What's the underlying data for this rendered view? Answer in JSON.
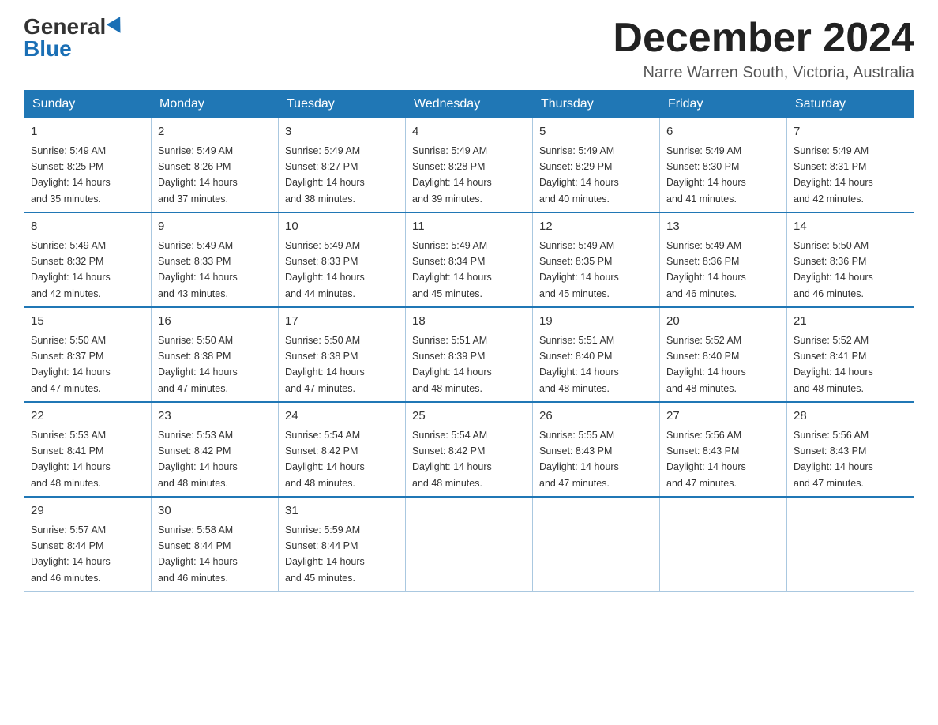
{
  "header": {
    "logo_general": "General",
    "logo_blue": "Blue",
    "month_title": "December 2024",
    "location": "Narre Warren South, Victoria, Australia"
  },
  "days_of_week": [
    "Sunday",
    "Monday",
    "Tuesday",
    "Wednesday",
    "Thursday",
    "Friday",
    "Saturday"
  ],
  "weeks": [
    [
      {
        "day": "1",
        "sunrise": "5:49 AM",
        "sunset": "8:25 PM",
        "daylight": "14 hours and 35 minutes."
      },
      {
        "day": "2",
        "sunrise": "5:49 AM",
        "sunset": "8:26 PM",
        "daylight": "14 hours and 37 minutes."
      },
      {
        "day": "3",
        "sunrise": "5:49 AM",
        "sunset": "8:27 PM",
        "daylight": "14 hours and 38 minutes."
      },
      {
        "day": "4",
        "sunrise": "5:49 AM",
        "sunset": "8:28 PM",
        "daylight": "14 hours and 39 minutes."
      },
      {
        "day": "5",
        "sunrise": "5:49 AM",
        "sunset": "8:29 PM",
        "daylight": "14 hours and 40 minutes."
      },
      {
        "day": "6",
        "sunrise": "5:49 AM",
        "sunset": "8:30 PM",
        "daylight": "14 hours and 41 minutes."
      },
      {
        "day": "7",
        "sunrise": "5:49 AM",
        "sunset": "8:31 PM",
        "daylight": "14 hours and 42 minutes."
      }
    ],
    [
      {
        "day": "8",
        "sunrise": "5:49 AM",
        "sunset": "8:32 PM",
        "daylight": "14 hours and 42 minutes."
      },
      {
        "day": "9",
        "sunrise": "5:49 AM",
        "sunset": "8:33 PM",
        "daylight": "14 hours and 43 minutes."
      },
      {
        "day": "10",
        "sunrise": "5:49 AM",
        "sunset": "8:33 PM",
        "daylight": "14 hours and 44 minutes."
      },
      {
        "day": "11",
        "sunrise": "5:49 AM",
        "sunset": "8:34 PM",
        "daylight": "14 hours and 45 minutes."
      },
      {
        "day": "12",
        "sunrise": "5:49 AM",
        "sunset": "8:35 PM",
        "daylight": "14 hours and 45 minutes."
      },
      {
        "day": "13",
        "sunrise": "5:49 AM",
        "sunset": "8:36 PM",
        "daylight": "14 hours and 46 minutes."
      },
      {
        "day": "14",
        "sunrise": "5:50 AM",
        "sunset": "8:36 PM",
        "daylight": "14 hours and 46 minutes."
      }
    ],
    [
      {
        "day": "15",
        "sunrise": "5:50 AM",
        "sunset": "8:37 PM",
        "daylight": "14 hours and 47 minutes."
      },
      {
        "day": "16",
        "sunrise": "5:50 AM",
        "sunset": "8:38 PM",
        "daylight": "14 hours and 47 minutes."
      },
      {
        "day": "17",
        "sunrise": "5:50 AM",
        "sunset": "8:38 PM",
        "daylight": "14 hours and 47 minutes."
      },
      {
        "day": "18",
        "sunrise": "5:51 AM",
        "sunset": "8:39 PM",
        "daylight": "14 hours and 48 minutes."
      },
      {
        "day": "19",
        "sunrise": "5:51 AM",
        "sunset": "8:40 PM",
        "daylight": "14 hours and 48 minutes."
      },
      {
        "day": "20",
        "sunrise": "5:52 AM",
        "sunset": "8:40 PM",
        "daylight": "14 hours and 48 minutes."
      },
      {
        "day": "21",
        "sunrise": "5:52 AM",
        "sunset": "8:41 PM",
        "daylight": "14 hours and 48 minutes."
      }
    ],
    [
      {
        "day": "22",
        "sunrise": "5:53 AM",
        "sunset": "8:41 PM",
        "daylight": "14 hours and 48 minutes."
      },
      {
        "day": "23",
        "sunrise": "5:53 AM",
        "sunset": "8:42 PM",
        "daylight": "14 hours and 48 minutes."
      },
      {
        "day": "24",
        "sunrise": "5:54 AM",
        "sunset": "8:42 PM",
        "daylight": "14 hours and 48 minutes."
      },
      {
        "day": "25",
        "sunrise": "5:54 AM",
        "sunset": "8:42 PM",
        "daylight": "14 hours and 48 minutes."
      },
      {
        "day": "26",
        "sunrise": "5:55 AM",
        "sunset": "8:43 PM",
        "daylight": "14 hours and 47 minutes."
      },
      {
        "day": "27",
        "sunrise": "5:56 AM",
        "sunset": "8:43 PM",
        "daylight": "14 hours and 47 minutes."
      },
      {
        "day": "28",
        "sunrise": "5:56 AM",
        "sunset": "8:43 PM",
        "daylight": "14 hours and 47 minutes."
      }
    ],
    [
      {
        "day": "29",
        "sunrise": "5:57 AM",
        "sunset": "8:44 PM",
        "daylight": "14 hours and 46 minutes."
      },
      {
        "day": "30",
        "sunrise": "5:58 AM",
        "sunset": "8:44 PM",
        "daylight": "14 hours and 46 minutes."
      },
      {
        "day": "31",
        "sunrise": "5:59 AM",
        "sunset": "8:44 PM",
        "daylight": "14 hours and 45 minutes."
      },
      null,
      null,
      null,
      null
    ]
  ],
  "labels": {
    "sunrise": "Sunrise:",
    "sunset": "Sunset:",
    "daylight": "Daylight:"
  }
}
